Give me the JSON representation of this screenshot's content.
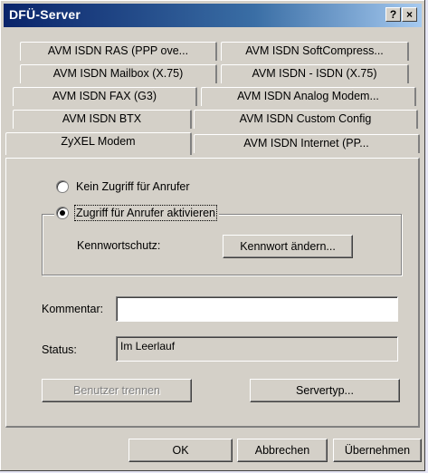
{
  "window": {
    "title": "DFÜ-Server",
    "help_glyph": "?",
    "close_glyph": "×"
  },
  "tabs": [
    {
      "label": "AVM ISDN RAS (PPP ove..."
    },
    {
      "label": "AVM ISDN SoftCompress..."
    },
    {
      "label": "AVM ISDN Mailbox (X.75)"
    },
    {
      "label": "AVM ISDN - ISDN (X.75)"
    },
    {
      "label": "AVM ISDN FAX (G3)"
    },
    {
      "label": "AVM ISDN Analog Modem..."
    },
    {
      "label": "AVM ISDN BTX"
    },
    {
      "label": "AVM ISDN Custom Config"
    },
    {
      "label": "ZyXEL Modem",
      "active": true
    },
    {
      "label": "AVM ISDN Internet (PP..."
    }
  ],
  "access": {
    "option_none": "Kein Zugriff für Anrufer",
    "option_enable": "Zugriff für Anrufer aktivieren",
    "selected": "option_enable"
  },
  "password": {
    "label": "Kennwortschutz:",
    "change_button": "Kennwort ändern..."
  },
  "comment": {
    "label": "Kommentar:",
    "value": ""
  },
  "status": {
    "label": "Status:",
    "value": "Im Leerlauf"
  },
  "actions": {
    "disconnect_button": "Benutzer trennen",
    "server_type_button": "Servertyp..."
  },
  "footer": {
    "ok": "OK",
    "cancel": "Abbrechen",
    "apply": "Übernehmen"
  }
}
